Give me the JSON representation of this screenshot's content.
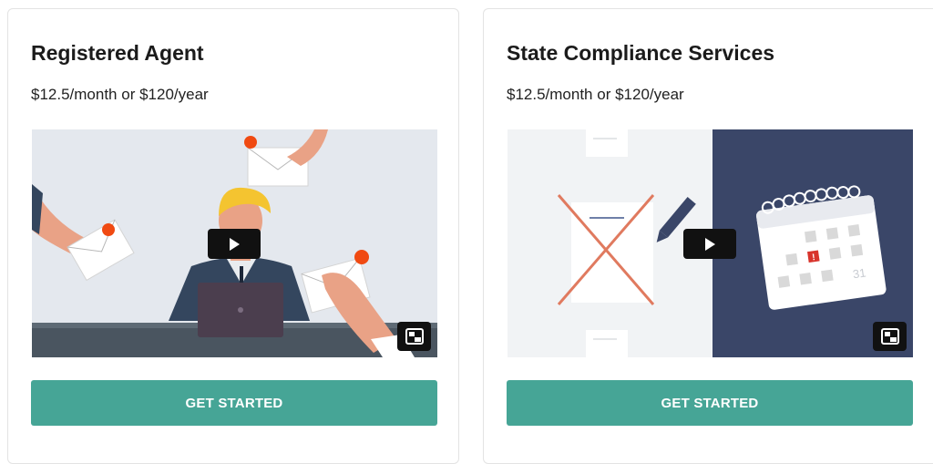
{
  "cards": [
    {
      "title": "Registered Agent",
      "price": "$12.5/month or $120/year",
      "cta_label": "GET STARTED",
      "video": {
        "play_icon": "play-icon",
        "pip_icon": "picture-in-picture-icon"
      }
    },
    {
      "title": "State Compliance Services",
      "price": "$12.5/month or $120/year",
      "cta_label": "GET STARTED",
      "video": {
        "play_icon": "play-icon",
        "pip_icon": "picture-in-picture-icon",
        "calendar_day": "31"
      }
    }
  ],
  "colors": {
    "accent": "#46a596",
    "notification": "#f04a12",
    "calendar_panel": "#3a4668"
  }
}
